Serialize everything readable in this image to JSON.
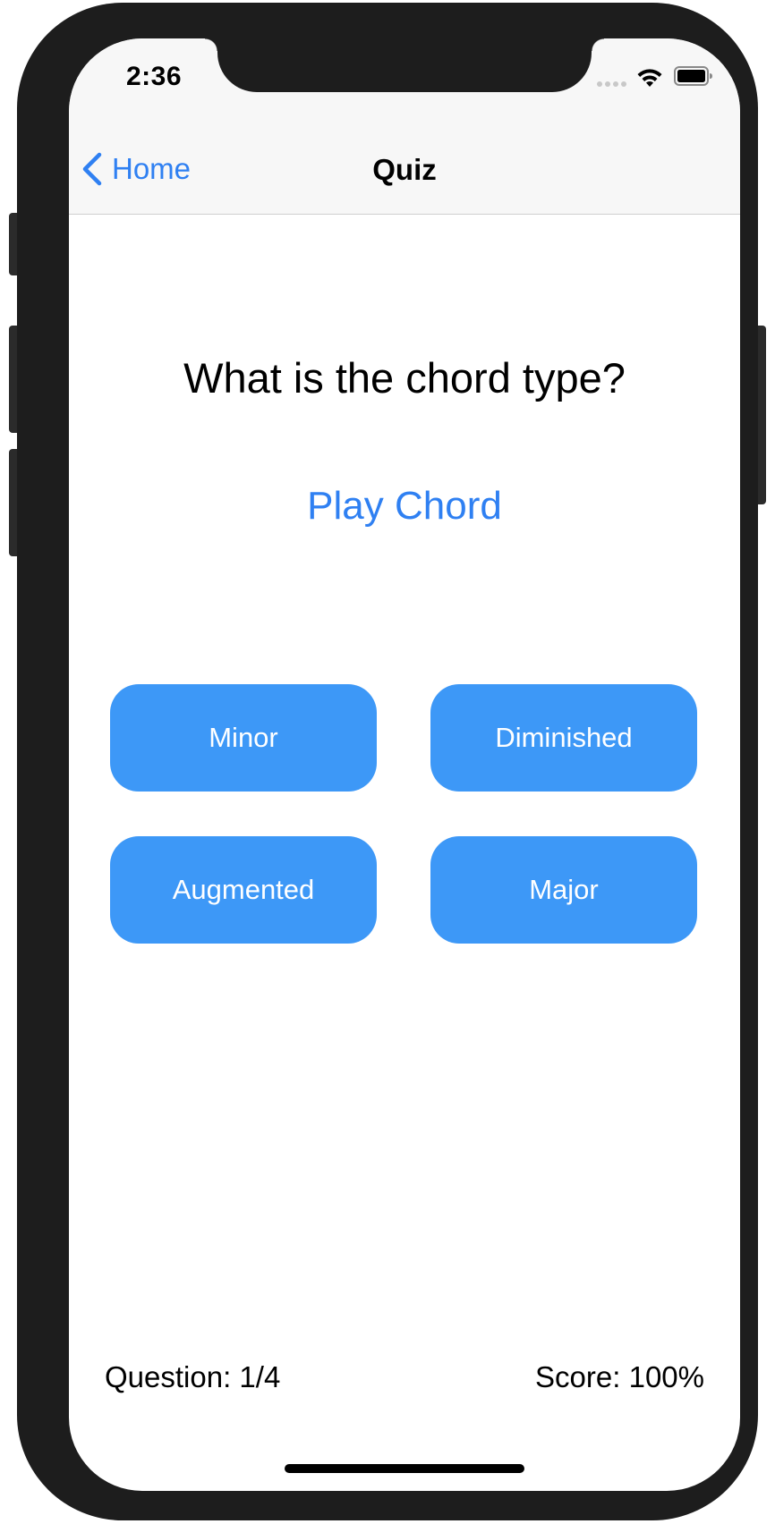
{
  "status_bar": {
    "time": "2:36",
    "icons": [
      "cellular-signal-icon",
      "wifi-icon",
      "battery-icon"
    ]
  },
  "nav": {
    "back_label": "Home",
    "title": "Quiz"
  },
  "quiz": {
    "question": "What is the chord type?",
    "play_label": "Play Chord",
    "answers": [
      "Minor",
      "Diminished",
      "Augmented",
      "Major"
    ]
  },
  "footer": {
    "question_progress": "Question: 1/4",
    "score": "Score: 100%"
  },
  "colors": {
    "accent": "#2f80f2",
    "button_fill": "#3d98f7",
    "nav_background": "#f7f7f7"
  }
}
